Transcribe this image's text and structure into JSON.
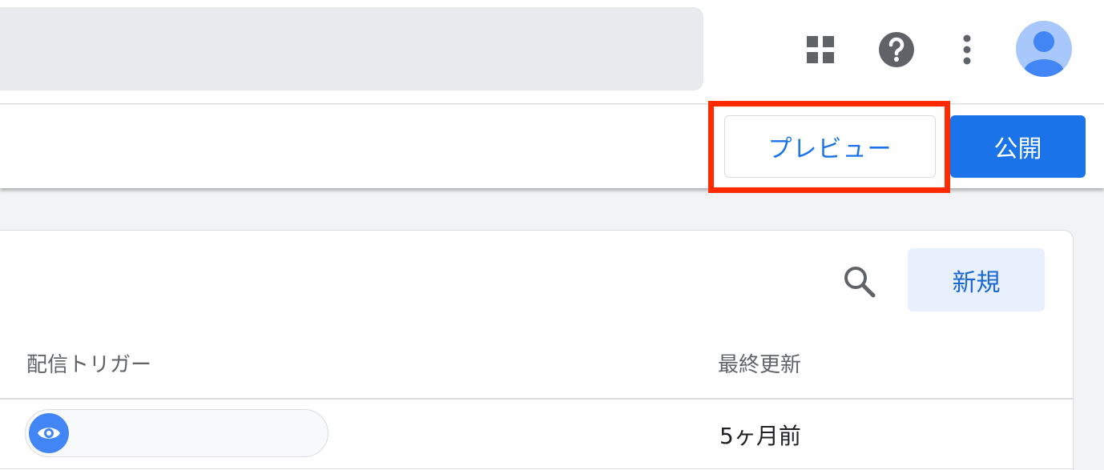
{
  "header": {
    "icons": [
      "apps-icon",
      "help-icon",
      "more-vert-icon",
      "avatar-icon"
    ]
  },
  "toolbar": {
    "preview_label": "プレビュー",
    "publish_label": "公開"
  },
  "card": {
    "new_label": "新規",
    "columns": {
      "trigger": "配信トリガー",
      "updated": "最終更新"
    },
    "rows": [
      {
        "trigger_icon": "eye-icon",
        "updated": "5ヶ月前"
      }
    ]
  },
  "colors": {
    "accent": "#1a73e8",
    "highlight": "#ff2a00",
    "new_button_bg": "#e8f0fe"
  }
}
